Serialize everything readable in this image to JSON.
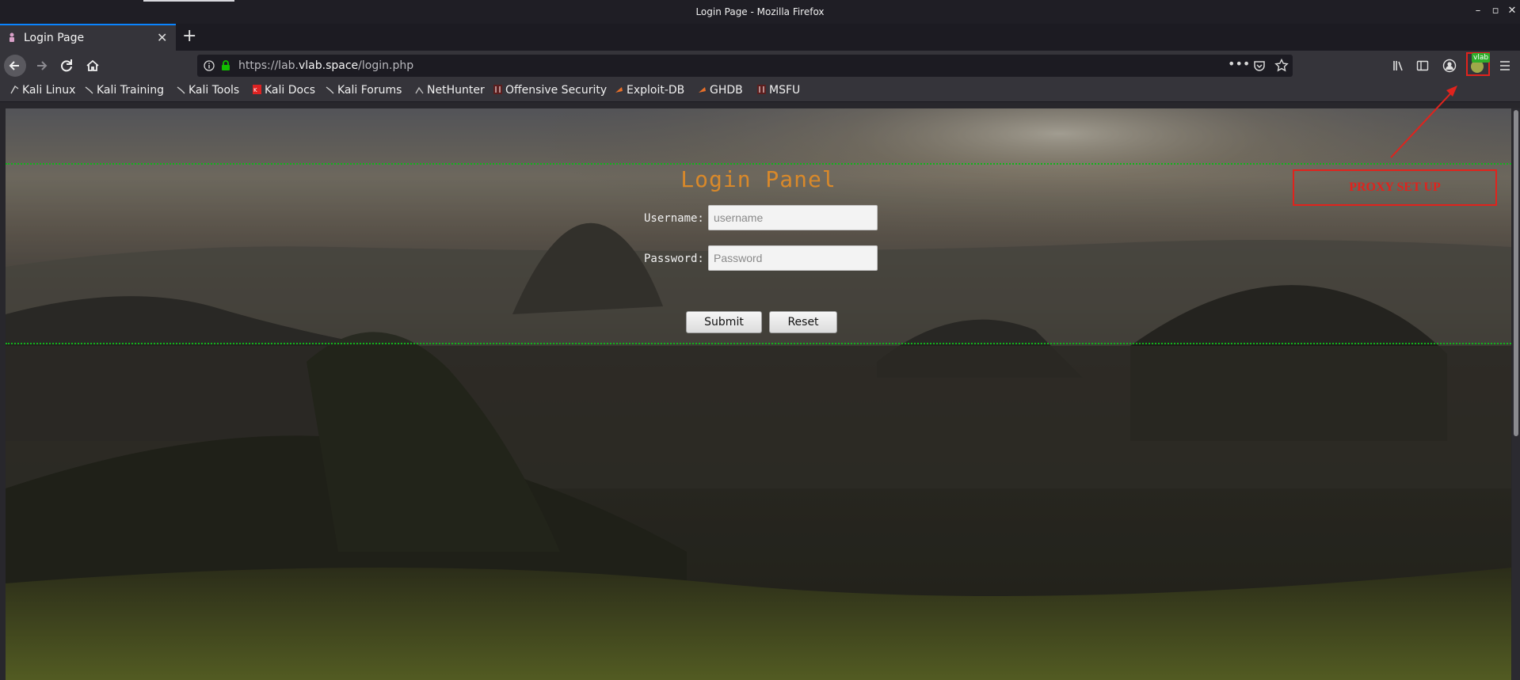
{
  "window": {
    "title": "Login Page - Mozilla Firefox"
  },
  "tab": {
    "title": "Login Page"
  },
  "urlbar": {
    "url_prefix": "https://lab.",
    "url_host": "vlab.space",
    "url_path": "/login.php"
  },
  "extension": {
    "badge": "vlab"
  },
  "bookmarks": [
    {
      "label": "Kali Linux"
    },
    {
      "label": "Kali Training"
    },
    {
      "label": "Kali Tools"
    },
    {
      "label": "Kali Docs"
    },
    {
      "label": "Kali Forums"
    },
    {
      "label": "NetHunter"
    },
    {
      "label": "Offensive Security"
    },
    {
      "label": "Exploit-DB"
    },
    {
      "label": "GHDB"
    },
    {
      "label": "MSFU"
    }
  ],
  "login": {
    "title": "Login Panel",
    "username_label": "Username:",
    "username_placeholder": "username",
    "password_label": "Password:",
    "password_placeholder": "Password",
    "submit_label": "Submit",
    "reset_label": "Reset"
  },
  "annotation": {
    "text": "PROXY SET UP",
    "color": "#e0231d"
  },
  "colors": {
    "accent": "#0a84ff",
    "title": "#d9892a",
    "guide": "#12b31c"
  }
}
